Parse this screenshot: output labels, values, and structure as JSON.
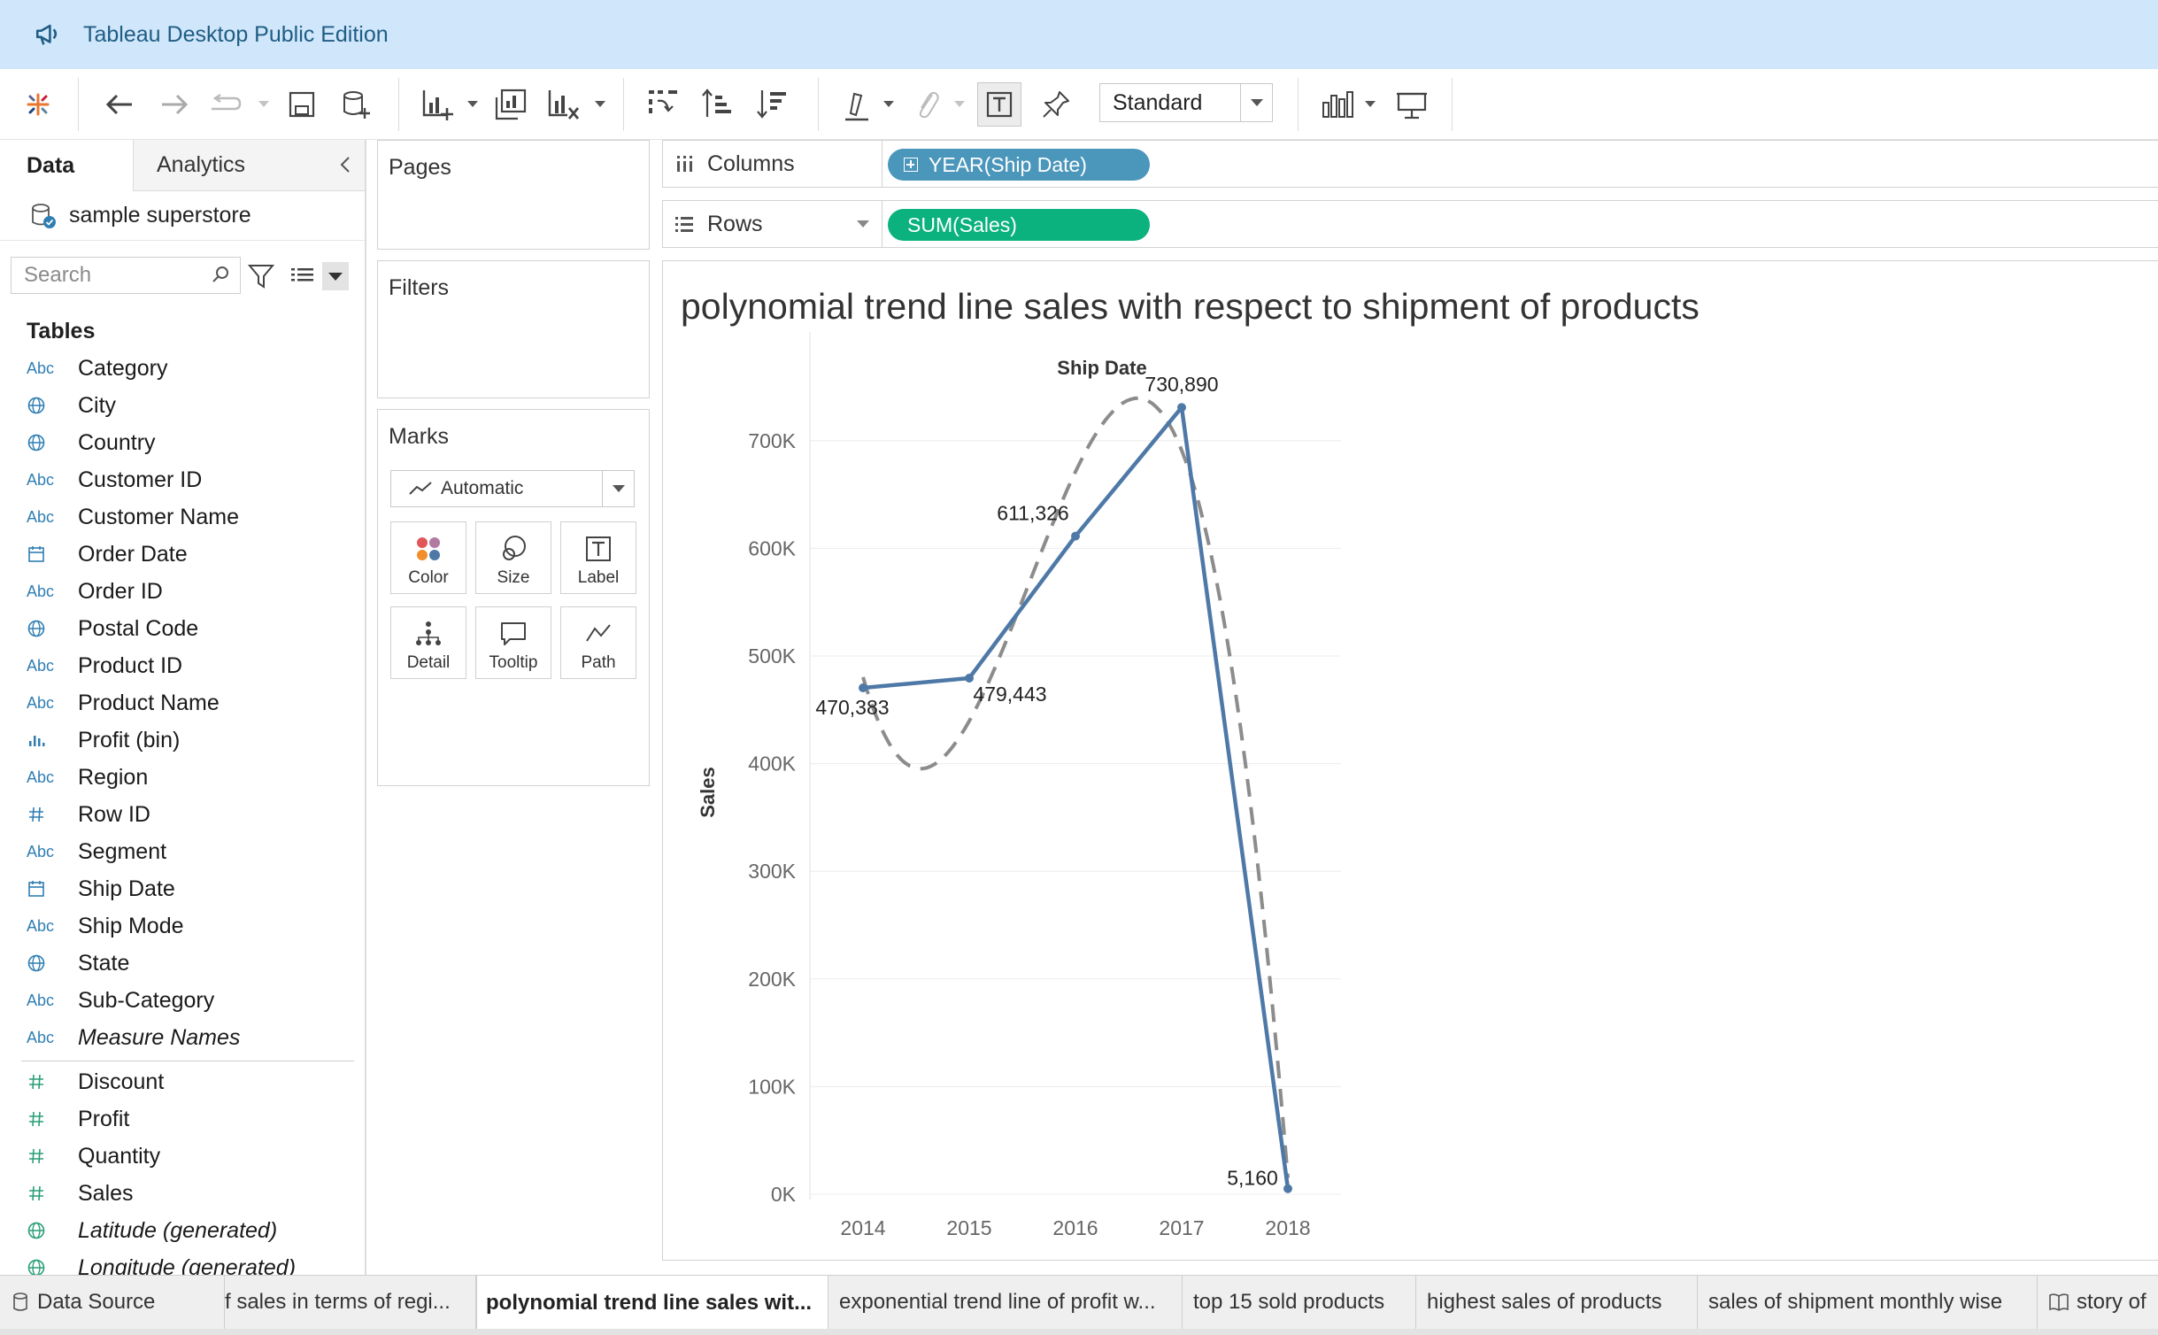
{
  "app": {
    "window_title": "Tableau Desktop Public Edition"
  },
  "toolbar": {
    "show_me_select": "Standard",
    "icons": [
      "tableau-logo-icon",
      "undo-icon",
      "redo-icon",
      "replay-icon",
      "save-icon",
      "new-datasource-icon",
      "new-worksheet-icon",
      "duplicate-sheet-icon",
      "clear-sheet-icon",
      "swap-icon",
      "sort-ascending-icon",
      "sort-descending-icon",
      "highlight-icon",
      "group-icon",
      "show-labels-icon",
      "pin-icon",
      "show-me-icon",
      "presentation-icon"
    ]
  },
  "data_pane": {
    "tab_data": "Data",
    "tab_analytics": "Analytics",
    "datasource_name": "sample superstore",
    "search_placeholder": "Search",
    "tables_header": "Tables",
    "dimensions": [
      {
        "icon": "Abc",
        "name": "Category"
      },
      {
        "icon": "globe",
        "name": "City"
      },
      {
        "icon": "globe",
        "name": "Country"
      },
      {
        "icon": "Abc",
        "name": "Customer ID"
      },
      {
        "icon": "Abc",
        "name": "Customer Name"
      },
      {
        "icon": "calendar",
        "name": "Order Date"
      },
      {
        "icon": "Abc",
        "name": "Order ID"
      },
      {
        "icon": "globe",
        "name": "Postal Code"
      },
      {
        "icon": "Abc",
        "name": "Product ID"
      },
      {
        "icon": "Abc",
        "name": "Product Name"
      },
      {
        "icon": "bin",
        "name": "Profit (bin)"
      },
      {
        "icon": "Abc",
        "name": "Region"
      },
      {
        "icon": "hash",
        "name": "Row ID"
      },
      {
        "icon": "Abc",
        "name": "Segment"
      },
      {
        "icon": "calendar",
        "name": "Ship Date"
      },
      {
        "icon": "Abc",
        "name": "Ship Mode"
      },
      {
        "icon": "globe",
        "name": "State"
      },
      {
        "icon": "Abc",
        "name": "Sub-Category"
      },
      {
        "icon": "Abc",
        "name": "Measure Names"
      }
    ],
    "measures": [
      {
        "icon": "hash",
        "name": "Discount"
      },
      {
        "icon": "hash",
        "name": "Profit"
      },
      {
        "icon": "hash",
        "name": "Quantity"
      },
      {
        "icon": "hash",
        "name": "Sales"
      },
      {
        "icon": "globe",
        "name": "Latitude (generated)"
      },
      {
        "icon": "globe",
        "name": "Longitude (generated)"
      }
    ]
  },
  "shelves": {
    "pages": "Pages",
    "filters": "Filters",
    "marks": "Marks",
    "marks_type": "Automatic",
    "mark_buttons": [
      "Color",
      "Size",
      "Label",
      "Detail",
      "Tooltip",
      "Path"
    ],
    "columns_label": "Columns",
    "columns_pill": "YEAR(Ship Date)",
    "rows_label": "Rows",
    "rows_pill": "SUM(Sales)"
  },
  "view": {
    "title": "polynomial trend line sales with respect to shipment of products"
  },
  "chart_data": {
    "type": "line",
    "title": "polynomial trend line sales with respect to shipment of products",
    "xlabel": "Ship Date",
    "ylabel": "Sales",
    "categories": [
      "2014",
      "2015",
      "2016",
      "2017",
      "2018"
    ],
    "series": [
      {
        "values": [
          470383,
          479443,
          611326,
          730890,
          5160
        ],
        "color": "#4e79a7"
      }
    ],
    "data_labels": [
      "470,383",
      "479,443",
      "611,326",
      "730,890",
      "5,160"
    ],
    "trend_line": {
      "type": "polynomial",
      "style": "dashed",
      "color": "#8c8c8c"
    },
    "y_ticks": [
      "0K",
      "100K",
      "200K",
      "300K",
      "400K",
      "500K",
      "600K",
      "700K"
    ],
    "ylim": [
      0,
      700000
    ],
    "grid": true
  },
  "bottom_tabs": {
    "datasource": "Data Source",
    "tabs": [
      "f sales in terms of regi...",
      "polynomial trend line sales wit...",
      "exponential trend line of profit w...",
      "top 15 sold products",
      "highest sales of products",
      "sales of shipment monthly wise",
      "story of"
    ]
  }
}
